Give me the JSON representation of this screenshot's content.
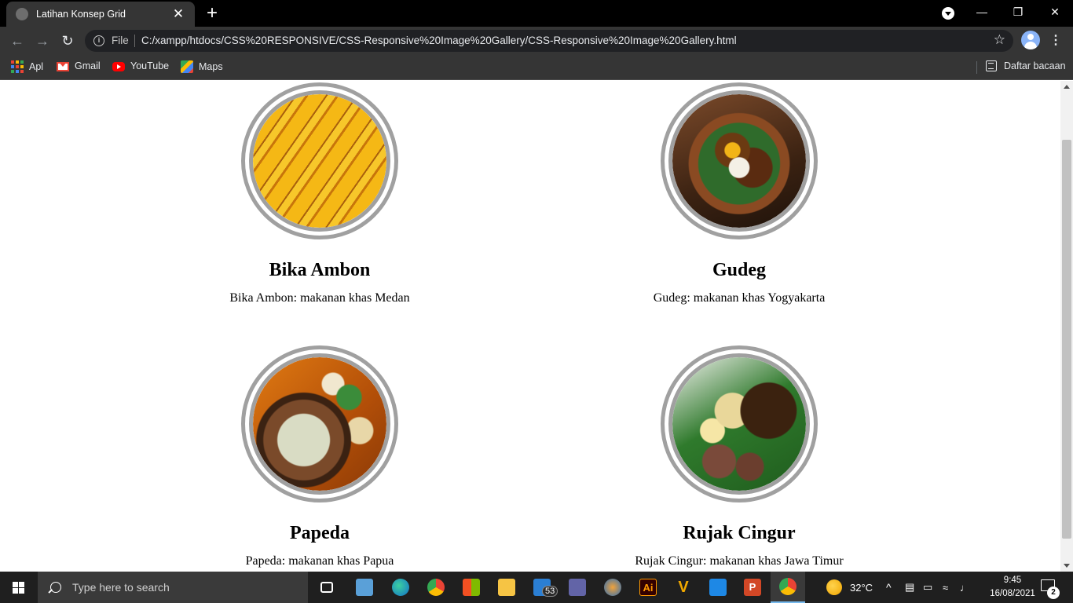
{
  "browser": {
    "tab_title": "Latihan Konsep Grid",
    "new_tab": "+",
    "close_tab": "✕",
    "scheme_label": "File",
    "url": "C:/xampp/htdocs/CSS%20RESPONSIVE/CSS-Responsive%20Image%20Gallery/CSS-Responsive%20Image%20Gallery.html",
    "bookmarks": [
      {
        "label": "Apl",
        "icon": "apps-grid-icon"
      },
      {
        "label": "Gmail",
        "icon": "gmail-icon"
      },
      {
        "label": "YouTube",
        "icon": "youtube-icon"
      },
      {
        "label": "Maps",
        "icon": "maps-icon"
      }
    ],
    "reading_list": "Daftar bacaan"
  },
  "gallery": [
    {
      "title": "Bika Ambon",
      "caption": "Bika Ambon: makanan khas Medan"
    },
    {
      "title": "Gudeg",
      "caption": "Gudeg: makanan khas Yogyakarta"
    },
    {
      "title": "Papeda",
      "caption": "Papeda: makanan khas Papua"
    },
    {
      "title": "Rujak Cingur",
      "caption": "Rujak Cingur: makanan khas Jawa Timur"
    }
  ],
  "taskbar": {
    "search_placeholder": "Type here to search",
    "mail_badge": "53",
    "illustrator_label": "Ai",
    "powerpoint_label": "P",
    "weather": "32°C",
    "time": "9:45",
    "date": "16/08/2021",
    "notifications": "2"
  },
  "colors": {
    "frame_border": "#a0a0a0",
    "chrome_toolbar": "#353535",
    "taskbar": "#1f1f1f"
  }
}
